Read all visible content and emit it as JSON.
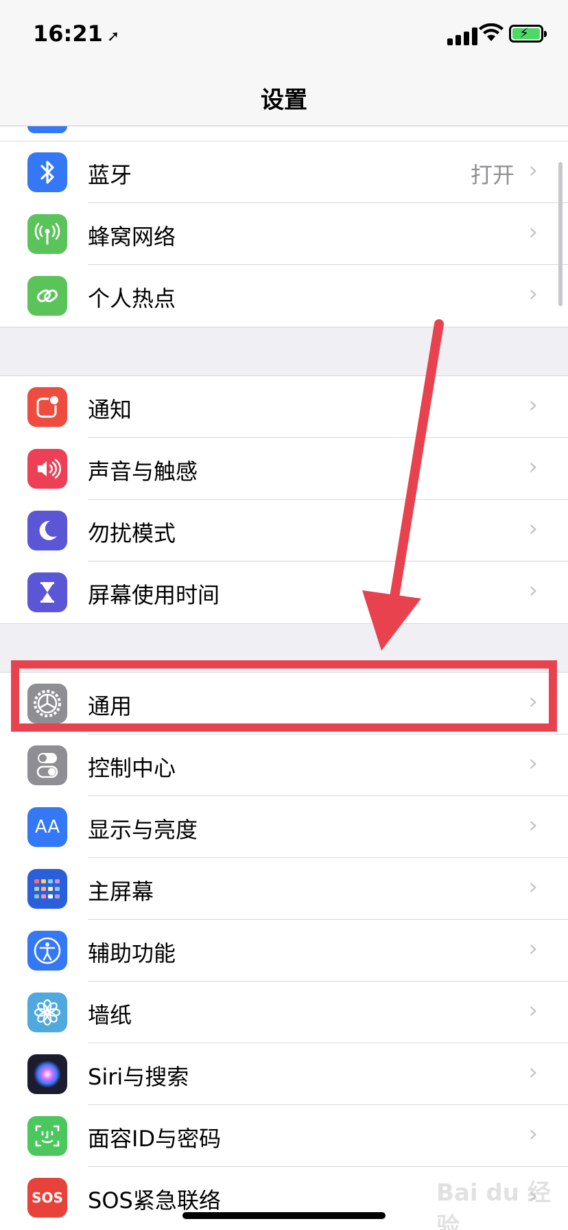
{
  "status_bar": {
    "time": "16:21",
    "location_glyph": "➚"
  },
  "nav": {
    "title": "设置"
  },
  "rows": [
    {
      "label": "蓝牙",
      "value": "打开",
      "icon": "bluetooth-icon",
      "color": "#3478f6"
    },
    {
      "label": "蜂窝网络",
      "value": "",
      "icon": "antenna-icon",
      "color": "#5ac45b"
    },
    {
      "label": "个人热点",
      "value": "",
      "icon": "hotspot-link-icon",
      "color": "#5ac45b"
    },
    {
      "label": "通知",
      "value": "",
      "icon": "notification-icon",
      "color": "#ed4c3e"
    },
    {
      "label": "声音与触感",
      "value": "",
      "icon": "speaker-icon",
      "color": "#ed3f56"
    },
    {
      "label": "勿扰模式",
      "value": "",
      "icon": "moon-icon",
      "color": "#5a56d6"
    },
    {
      "label": "屏幕使用时间",
      "value": "",
      "icon": "hourglass-icon",
      "color": "#5a56d6"
    },
    {
      "label": "通用",
      "value": "",
      "icon": "gear-icon",
      "color": "#8e8e93"
    },
    {
      "label": "控制中心",
      "value": "",
      "icon": "toggles-icon",
      "color": "#8e8e93"
    },
    {
      "label": "显示与亮度",
      "value": "",
      "icon": "text-size-icon",
      "color": "#3478f6"
    },
    {
      "label": "主屏幕",
      "value": "",
      "icon": "home-grid-icon",
      "color": "#2a5fdc"
    },
    {
      "label": "辅助功能",
      "value": "",
      "icon": "accessibility-icon",
      "color": "#3478f6"
    },
    {
      "label": "墙纸",
      "value": "",
      "icon": "flower-icon",
      "color": "#4fa8de"
    },
    {
      "label": "Siri与搜索",
      "value": "",
      "icon": "siri-icon",
      "color": "#1c1c2e"
    },
    {
      "label": "面容ID与密码",
      "value": "",
      "icon": "face-id-icon",
      "color": "#4cc75e"
    },
    {
      "label": "SOS紧急联络",
      "value": "",
      "icon": "sos-icon",
      "color": "#e8433a"
    }
  ],
  "icon_text": {
    "display": "AA",
    "sos": "SOS"
  },
  "chevron": "›",
  "annotation": {
    "highlight_color": "#e8424f"
  },
  "watermark": "Bai du 经验"
}
